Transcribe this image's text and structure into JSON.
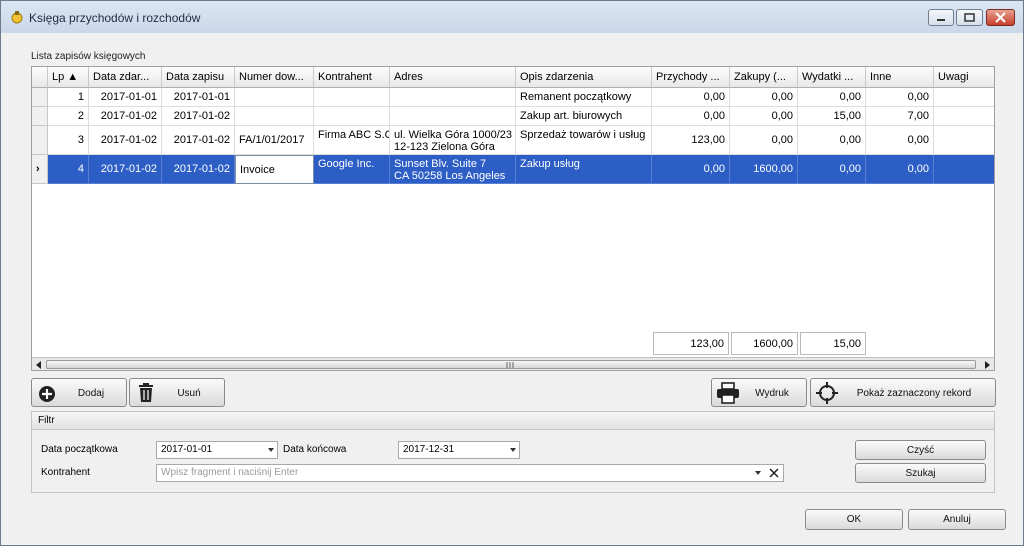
{
  "window": {
    "title": "Księga przychodów i rozchodów",
    "accent": "#2d5ec6"
  },
  "list_label": "Lista zapisów księgowych",
  "columns": [
    "Lp ▲",
    "Data zdar...",
    "Data zapisu",
    "Numer dow...",
    "Kontrahent",
    "Adres",
    "Opis zdarzenia",
    "Przychody ...",
    "Zakupy (...",
    "Wydatki ...",
    "Inne",
    "Uwagi"
  ],
  "rows": [
    {
      "lp": "1",
      "data_zdarzenia": "2017-01-01",
      "data_zapisu": "2017-01-01",
      "numer": "",
      "kontrahent": "",
      "adres": "",
      "opis": "Remanent początkowy",
      "przychody": "0,00",
      "zakupy": "0,00",
      "wydatki": "0,00",
      "inne": "0,00",
      "uwagi": ""
    },
    {
      "lp": "2",
      "data_zdarzenia": "2017-01-02",
      "data_zapisu": "2017-01-02",
      "numer": "",
      "kontrahent": "",
      "adres": "",
      "opis": "Zakup art. biurowych",
      "przychody": "0,00",
      "zakupy": "0,00",
      "wydatki": "15,00",
      "inne": "7,00",
      "uwagi": ""
    },
    {
      "lp": "3",
      "data_zdarzenia": "2017-01-02",
      "data_zapisu": "2017-01-02",
      "numer": "FA/1/01/2017",
      "kontrahent": "Firma ABC S.C.",
      "adres": "ul. Wielka Góra 1000/23",
      "adres2": "12-123 Zielona Góra",
      "opis": "Sprzedaż towarów i usług",
      "przychody": "123,00",
      "zakupy": "0,00",
      "wydatki": "0,00",
      "inne": "0,00",
      "uwagi": ""
    },
    {
      "lp": "4",
      "data_zdarzenia": "2017-01-02",
      "data_zapisu": "2017-01-02",
      "numer": "Invoice",
      "kontrahent": "Google Inc.",
      "adres": "Sunset Blv. Suite 7",
      "adres2": "CA 50258 Los Angeles",
      "opis": "Zakup usług",
      "przychody": "0,00",
      "zakupy": "1600,00",
      "wydatki": "0,00",
      "inne": "0,00",
      "uwagi": ""
    }
  ],
  "row_indicator": "›",
  "totals": {
    "przychody": "123,00",
    "zakupy": "1600,00",
    "wydatki": "15,00"
  },
  "buttons": {
    "add": "Dodaj",
    "remove": "Usuń",
    "print": "Wydruk",
    "show": "Pokaż zaznaczony rekord",
    "clear": "Czyść",
    "search": "Szukaj",
    "ok": "OK",
    "cancel": "Anuluj"
  },
  "filter": {
    "title": "Filtr",
    "start_label": "Data początkowa",
    "start_value": "2017-01-01",
    "end_label": "Data końcowa",
    "end_value": "2017-12-31",
    "contractor_label": "Kontrahent",
    "contractor_placeholder": "Wpisz fragment i naciśnij Enter"
  }
}
